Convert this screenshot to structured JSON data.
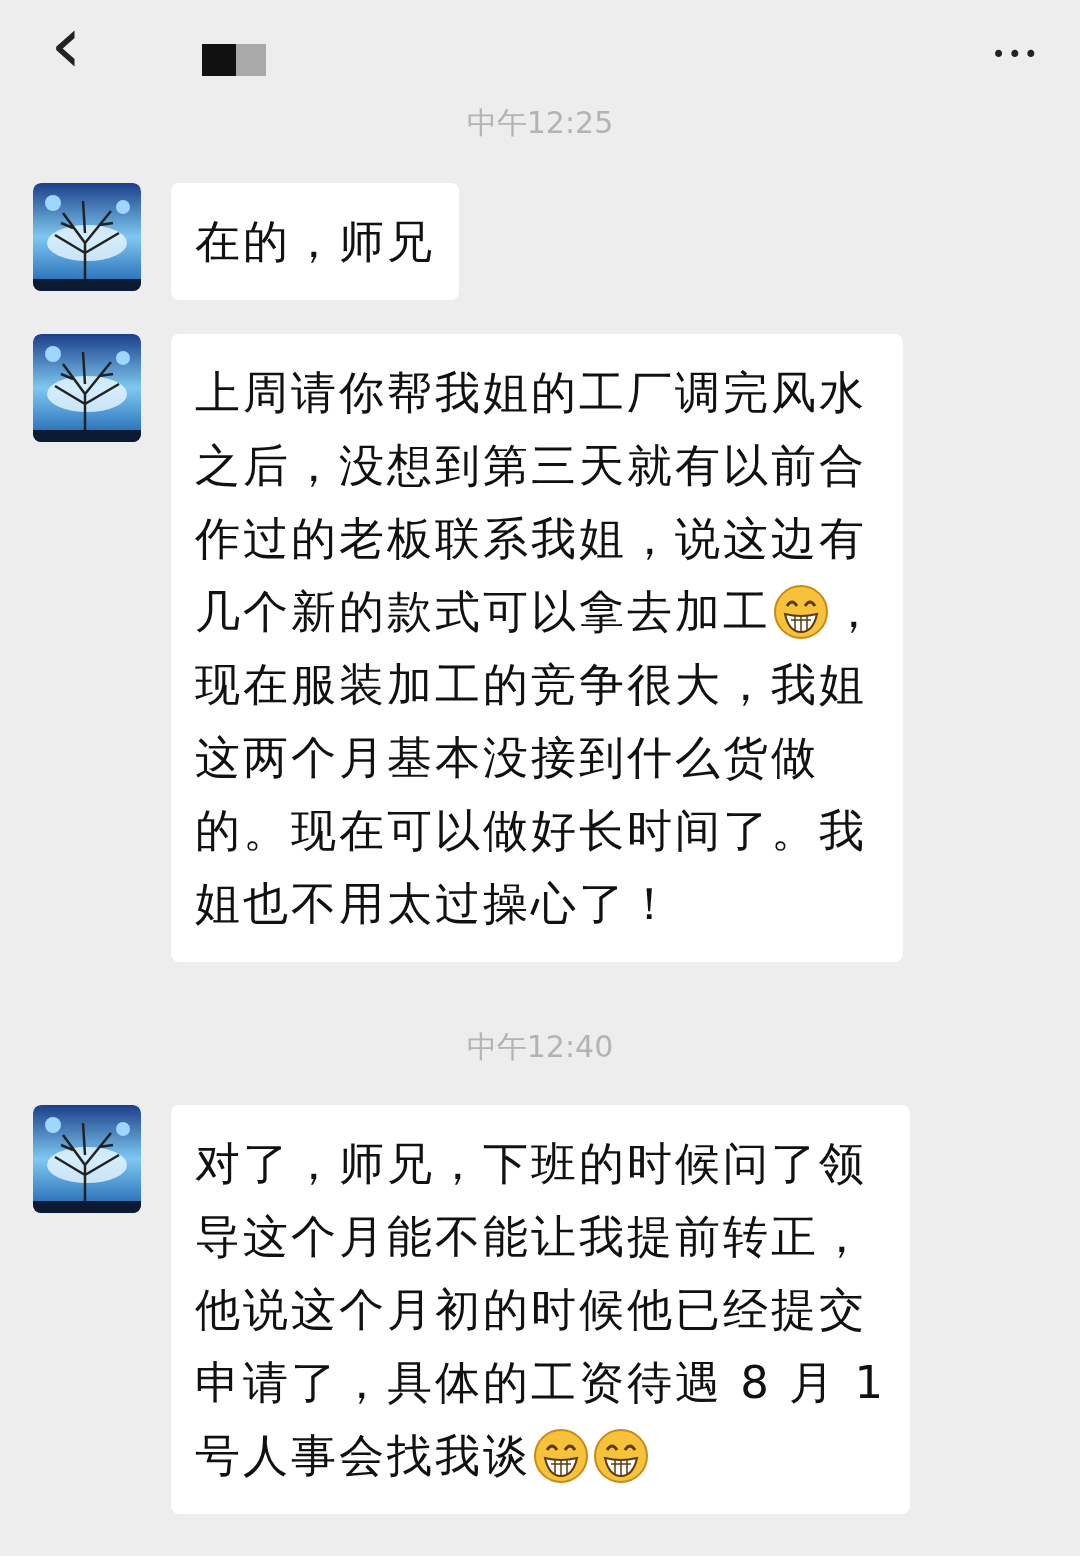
{
  "header": {
    "back": "‹",
    "more": "•••"
  },
  "messages": [
    {
      "kind": "time",
      "text": "中午12:25"
    },
    {
      "kind": "incoming",
      "lines": [
        [
          {
            "kind": "text",
            "text": "在的，师兄"
          }
        ]
      ]
    },
    {
      "kind": "incoming",
      "lines": [
        [
          {
            "kind": "text",
            "text": "上周请你帮我姐的工厂调完风水"
          }
        ],
        [
          {
            "kind": "text",
            "text": "之后，没想到第三天就有以前合"
          }
        ],
        [
          {
            "kind": "text",
            "text": "作过的老板联系我姐，说这边有"
          }
        ],
        [
          {
            "kind": "text",
            "text": "几个新的款式可以拿去加工"
          },
          {
            "kind": "emoji"
          },
          {
            "kind": "text",
            "text": "，"
          }
        ],
        [
          {
            "kind": "text",
            "text": "现在服装加工的竞争很大，我姐"
          }
        ],
        [
          {
            "kind": "text",
            "text": "这两个月基本没接到什么货做"
          }
        ],
        [
          {
            "kind": "text",
            "text": "的。现在可以做好长时间了。我"
          }
        ],
        [
          {
            "kind": "text",
            "text": "姐也不用太过操心了！"
          }
        ]
      ]
    },
    {
      "kind": "time",
      "text": "中午12:40"
    },
    {
      "kind": "incoming",
      "lines": [
        [
          {
            "kind": "text",
            "text": "对了，师兄，下班的时候问了领"
          }
        ],
        [
          {
            "kind": "text",
            "text": "导这个月能不能让我提前转正，"
          }
        ],
        [
          {
            "kind": "text",
            "text": "他说这个月初的时候他已经提交"
          }
        ],
        [
          {
            "kind": "text",
            "text": "申请了，具体的工资待遇 8 月 1"
          }
        ],
        [
          {
            "kind": "text",
            "text": "号人事会找我谈"
          },
          {
            "kind": "emoji"
          },
          {
            "kind": "emoji"
          }
        ]
      ]
    }
  ]
}
